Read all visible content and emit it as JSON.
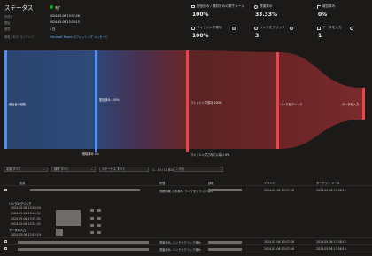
{
  "status": {
    "title": "ステータス",
    "state": "完了",
    "created_label": "作成日",
    "created_value": "2024-05-06 13:37:26",
    "started_label": "開始",
    "started_value": "2024-05-06 13:38:15",
    "duration_label": "期間",
    "duration_value": "1 日",
    "content_label": "使用された コンテンツ",
    "content_value": "Microsoft Teams のフィッシング メッセージ"
  },
  "metrics": [
    {
      "label": "配信済み / 開封済みの電子メール",
      "value": "100%"
    },
    {
      "label": "侵害済み",
      "value": "33.33%"
    },
    {
      "label": "報告済み",
      "value": "0%"
    },
    {
      "label": "フィッシング成功",
      "value": "100%"
    },
    {
      "label": "リンクをクリック",
      "value": "3"
    },
    {
      "label": "データを入力",
      "value": "1"
    }
  ],
  "sankey": {
    "nodes": [
      "受信者の総数",
      "配信済み 100%",
      "削除済み 0%",
      "フィッシング成功 100%",
      "フィッシングされていない 0%",
      "リンクをクリック",
      "データを入力"
    ]
  },
  "toolbar": {
    "filter1": "名前 すべて",
    "filter2": "部署 すべて",
    "filter3": "ステータス すべて",
    "count": "1 – 10 / 10 件のうち 10",
    "search_placeholder": "検索"
  },
  "table": {
    "headers": [
      "名前",
      "",
      "状態",
      "部署",
      "イベント",
      "",
      "ターゲット メール"
    ],
    "expanded": {
      "group_title": "リンクのクリック",
      "events": [
        "2024-05-06 13:49:29",
        "2024-05-06 13:49:31",
        "2024-05-06 13:51:31",
        "2024-05-06 13:51:31"
      ],
      "data_title": "データの入力",
      "data_events": [
        "2024-05-06 13:52:19"
      ]
    },
    "rows": [
      {
        "state": "資格情報 入手済み, リンクをクリック済み",
        "date": "2024-05-06 13:37:26",
        "time": "2024-05-06 13:38:15"
      },
      {
        "state": "侵害済み, リンクをクリック済み",
        "date": "2024-05-06 13:37:26",
        "time": "2024-05-06 13:38:15"
      },
      {
        "state": "侵害済み, リンクをクリック済み",
        "date": "2024-05-06 13:37:26",
        "time": "2024-05-06 13:38:15"
      }
    ]
  },
  "colors": {
    "blue": "#4f8ef7",
    "red": "#e8464b",
    "green": "#13a10e",
    "bg": "#1b1a19"
  }
}
